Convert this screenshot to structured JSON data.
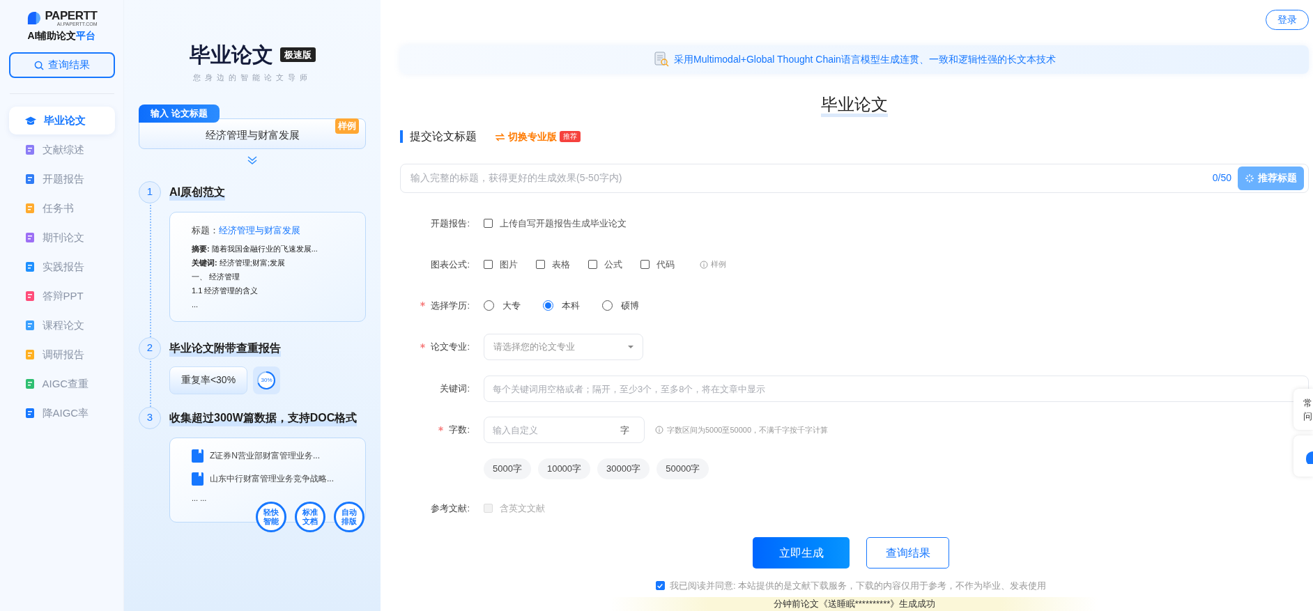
{
  "sidebar": {
    "brand": "PAPERTT",
    "domain": "AI.PAPERTT.COM",
    "tagline": "AI辅助论文",
    "tagline_accent": "平台",
    "query_button": "查询结果",
    "nav": [
      {
        "label": "毕业论文",
        "selected": true
      },
      {
        "label": "文献综述",
        "selected": false
      },
      {
        "label": "开题报告",
        "selected": false
      },
      {
        "label": "任务书",
        "selected": false
      },
      {
        "label": "期刊论文",
        "selected": false
      },
      {
        "label": "实践报告",
        "selected": false
      },
      {
        "label": "答辩PPT",
        "selected": false
      },
      {
        "label": "课程论文",
        "selected": false
      },
      {
        "label": "调研报告",
        "selected": false
      },
      {
        "label": "AIGC查重",
        "selected": false
      },
      {
        "label": "降AIGC率",
        "selected": false
      }
    ]
  },
  "showcase": {
    "title": "毕业论文",
    "badge": "极速版",
    "subtitle": "您身边的智能论文导师",
    "input_tab": "输入 论文标题",
    "example_title": "经济管理与财富发展",
    "sample_badge": "样例",
    "steps": [
      {
        "number": "1",
        "title": "AI原创范文"
      },
      {
        "number": "2",
        "title": "毕业论文附带查重报告"
      },
      {
        "number": "3",
        "title": "收集超过300W篇数据，支持DOC格式"
      }
    ],
    "essay_card": {
      "title_label": "标题：",
      "title_value": "经济管理与财富发展",
      "lines": [
        "**摘要:** 随着我国金融行业的飞速发展...",
        "**关键词:** 经济管理;财富;发展",
        "一、 经济管理",
        "1.1 经济管理的含义",
        "..."
      ]
    },
    "similarity": {
      "label": "重复率<30%",
      "ring_text": "30%"
    },
    "references": [
      "Z证券N营业部财富管理业务...",
      "山东中行财富管理业务竞争战略..."
    ],
    "references_more": "... ...",
    "features": [
      [
        "轻快",
        "智能"
      ],
      [
        "标准",
        "文档"
      ],
      [
        "自动",
        "排版"
      ]
    ]
  },
  "main": {
    "login": "登录",
    "banner": "采用Multimodal+Global Thought Chain语言模型生成连贯、一致和逻辑性强的长文本技术",
    "heading": "毕业论文",
    "section": "提交论文标题",
    "switch_link": "切换专业版",
    "switch_badge": "推荐",
    "title_input": {
      "placeholder": "输入完整的标题，获得更好的生成效果(5-50字内)",
      "counter": "0/50",
      "button": "推荐标题"
    },
    "rows": [
      {
        "kind": "checkbox",
        "label": "开题报告:",
        "required": false,
        "options": [
          {
            "label": "上传自写开题报告生成毕业论文",
            "checked": false,
            "disabled": false
          }
        ]
      },
      {
        "kind": "checkbox",
        "label": "图表公式:",
        "required": false,
        "options": [
          {
            "label": "图片",
            "checked": false,
            "disabled": false
          },
          {
            "label": "表格",
            "checked": false,
            "disabled": false
          },
          {
            "label": "公式",
            "checked": false,
            "disabled": false
          },
          {
            "label": "代码",
            "checked": false,
            "disabled": false
          }
        ],
        "hint": "样例"
      },
      {
        "kind": "radio",
        "label": "选择学历:",
        "required": true,
        "options": [
          {
            "label": "大专",
            "selected": false
          },
          {
            "label": "本科",
            "selected": true
          },
          {
            "label": "硕博",
            "selected": false
          }
        ]
      },
      {
        "kind": "select",
        "label": "论文专业:",
        "required": true,
        "placeholder": "请选择您的论文专业"
      },
      {
        "kind": "text",
        "label": "关键词:",
        "required": false,
        "placeholder": "每个关键词用空格或者；隔开，至少3个，至多8个，将在文章中显示"
      },
      {
        "kind": "number",
        "label": "字数:",
        "required": true,
        "placeholder": "输入自定义",
        "unit": "字",
        "hint": "字数区间为5000至50000，不满千字按千字计算"
      },
      {
        "kind": "chips",
        "options": [
          "5000字",
          "10000字",
          "30000字",
          "50000字"
        ]
      },
      {
        "kind": "checkbox",
        "label": "参考文献:",
        "required": false,
        "options": [
          {
            "label": "含英文文献",
            "checked": false,
            "disabled": true
          }
        ]
      }
    ],
    "actions": {
      "primary": "立即生成",
      "secondary": "查询结果"
    },
    "agreement": {
      "checked": true,
      "text": "我已阅读并同意: 本站提供的是文献下载服务，下载的内容仅用于参考，不作为毕业、发表使用"
    },
    "ticker": "分钟前论文《送睡眠**********》生成成功"
  },
  "float": {
    "faq": [
      "常",
      "问"
    ]
  }
}
